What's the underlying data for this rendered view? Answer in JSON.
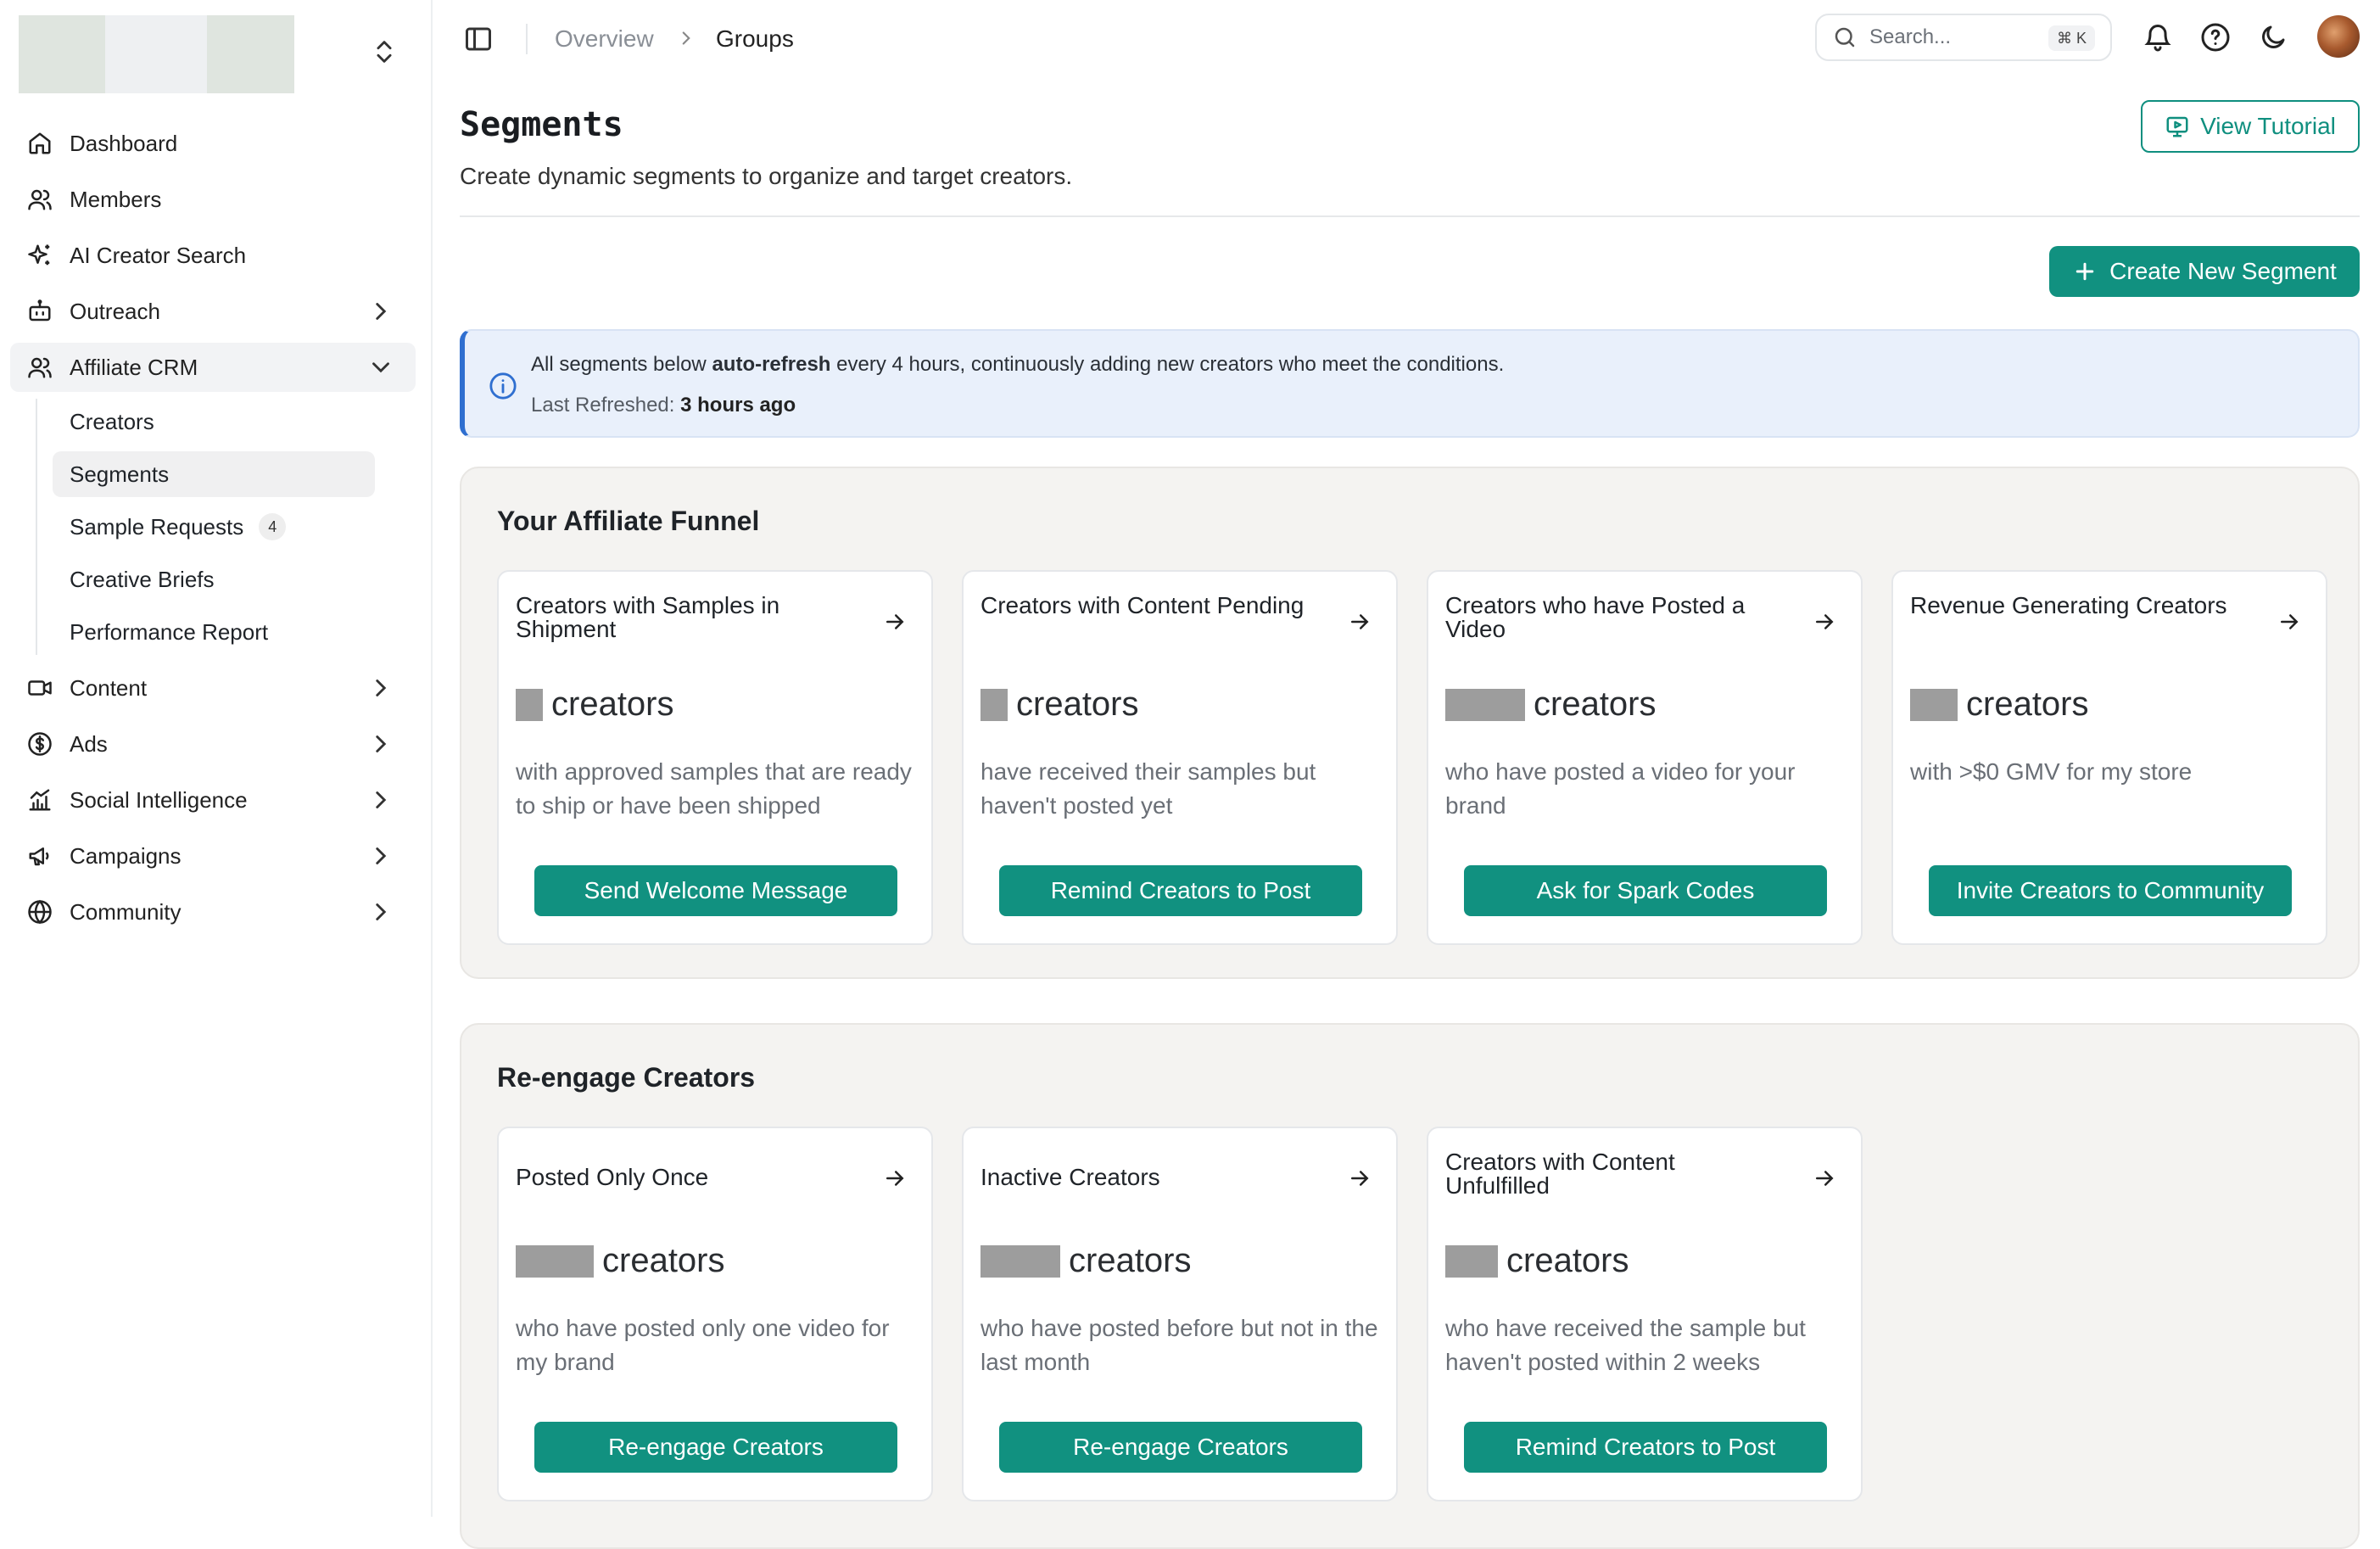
{
  "sidebar": {
    "items": [
      {
        "label": "Dashboard",
        "icon": "home-icon"
      },
      {
        "label": "Members",
        "icon": "users-icon"
      },
      {
        "label": "AI Creator Search",
        "icon": "sparkles-icon"
      },
      {
        "label": "Outreach",
        "icon": "bot-icon"
      },
      {
        "label": "Affiliate CRM",
        "icon": "users-icon"
      },
      {
        "label": "Content",
        "icon": "video-icon"
      },
      {
        "label": "Ads",
        "icon": "dollar-icon"
      },
      {
        "label": "Social Intelligence",
        "icon": "bar-chart-icon"
      },
      {
        "label": "Campaigns",
        "icon": "megaphone-icon"
      },
      {
        "label": "Community",
        "icon": "globe-icon"
      }
    ],
    "sub_items": [
      {
        "label": "Creators"
      },
      {
        "label": "Segments"
      },
      {
        "label": "Sample Requests",
        "badge": "4"
      },
      {
        "label": "Creative Briefs"
      },
      {
        "label": "Performance Report"
      }
    ]
  },
  "topbar": {
    "breadcrumb": [
      "Overview",
      "Groups"
    ],
    "search_placeholder": "Search...",
    "search_shortcut": "⌘ K"
  },
  "header": {
    "title": "Segments",
    "subtitle": "Create dynamic segments to organize and target creators.",
    "tutorial_label": "View Tutorial",
    "create_label": "Create New Segment"
  },
  "info": {
    "pre": "All segments below ",
    "bold": "auto-refresh",
    "post": " every 4 hours, continuously adding new creators who meet the conditions.",
    "refreshed_label": "Last Refreshed: ",
    "refreshed_value": "3 hours ago"
  },
  "sections": [
    {
      "title": "Your Affiliate Funnel",
      "cards": [
        {
          "title": "Creators with Samples in Shipment",
          "count_label": "creators",
          "desc": "with approved samples that are ready to ship or have been shipped",
          "button": "Send Welcome Message"
        },
        {
          "title": "Creators with Content Pending",
          "count_label": "creators",
          "desc": "have received their samples but haven't posted yet",
          "button": "Remind Creators to Post"
        },
        {
          "title": "Creators who have Posted a Video",
          "count_label": "creators",
          "desc": "who have posted a video for your brand",
          "button": "Ask for Spark Codes"
        },
        {
          "title": "Revenue Generating Creators",
          "count_label": "creators",
          "desc": "with >$0 GMV for my store",
          "button": "Invite Creators to Community"
        }
      ]
    },
    {
      "title": "Re-engage Creators",
      "cards": [
        {
          "title": "Posted Only Once",
          "count_label": "creators",
          "desc": "who have posted only one video for my brand",
          "button": "Re-engage Creators"
        },
        {
          "title": "Inactive Creators",
          "count_label": "creators",
          "desc": "who have posted before but not in the last month",
          "button": "Re-engage Creators"
        },
        {
          "title": "Creators with Content Unfulfilled",
          "count_label": "creators",
          "desc": "who have received the sample but haven't posted within 2 weeks",
          "button": "Remind Creators to Post"
        }
      ]
    }
  ],
  "colors": {
    "accent": "#119180",
    "info_border": "#2f6fd0",
    "info_bg": "#e9f0fb",
    "section_bg": "#f4f3f1"
  }
}
